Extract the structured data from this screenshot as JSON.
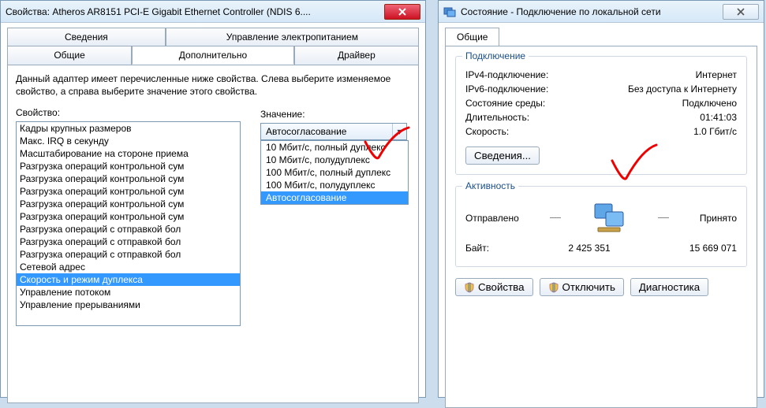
{
  "left": {
    "title": "Свойства: Atheros AR8151 PCI-E Gigabit Ethernet Controller (NDIS 6....",
    "tabs_top": [
      "Сведения",
      "Управление электропитанием"
    ],
    "tabs_bottom": [
      "Общие",
      "Дополнительно",
      "Драйвер"
    ],
    "active_tab": "Дополнительно",
    "desc": "Данный адаптер имеет перечисленные ниже свойства. Слева выберите изменяемое свойство, а справа выберите значение этого свойства.",
    "property_label": "Свойство:",
    "value_label": "Значение:",
    "properties": [
      "Кадры крупных размеров",
      "Макс. IRQ в секунду",
      "Масштабирование на стороне приема",
      "Разгрузка операций контрольной сум",
      "Разгрузка операций контрольной сум",
      "Разгрузка операций контрольной сум",
      "Разгрузка операций контрольной сум",
      "Разгрузка операций контрольной сум",
      "Разгрузка операций с отправкой бол",
      "Разгрузка операций с отправкой бол",
      "Разгрузка операций с отправкой бол",
      "Сетевой адрес",
      "Скорость и режим дуплекса",
      "Управление потоком",
      "Управление прерываниями"
    ],
    "selected_property_index": 12,
    "combo_value": "Автосогласование",
    "combo_options": [
      "10 Мбит/с, полный дуплекс",
      "10 Мбит/с, полудуплекс",
      "100 Мбит/с, полный дуплекс",
      "100 Мбит/с, полудуплекс",
      "Автосогласование"
    ],
    "combo_selected_index": 4
  },
  "right": {
    "title": "Состояние - Подключение по локальной сети",
    "tab": "Общие",
    "group_conn": "Подключение",
    "rows": [
      {
        "k": "IPv4-подключение:",
        "v": "Интернет"
      },
      {
        "k": "IPv6-подключение:",
        "v": "Без доступа к Интернету"
      },
      {
        "k": "Состояние среды:",
        "v": "Подключено"
      },
      {
        "k": "Длительность:",
        "v": "01:41:03"
      },
      {
        "k": "Скорость:",
        "v": "1.0 Гбит/с"
      }
    ],
    "details_btn": "Сведения...",
    "group_act": "Активность",
    "sent_label": "Отправлено",
    "recv_label": "Принято",
    "bytes_label": "Байт:",
    "bytes_sent": "2 425 351",
    "bytes_recv": "15 669 071",
    "btn_props": "Свойства",
    "btn_disable": "Отключить",
    "btn_diag": "Диагностика"
  }
}
